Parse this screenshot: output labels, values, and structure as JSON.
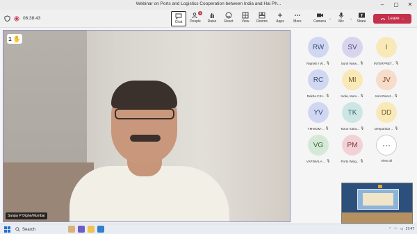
{
  "window": {
    "title": "Webinar on Ports and Logistics Cooperation between India and Hai Ph..."
  },
  "status": {
    "timer": "06:38:43"
  },
  "toolbar": {
    "chat": "Chat",
    "people": "People",
    "people_badge": "1",
    "raise": "Raise",
    "react": "React",
    "view": "View",
    "rooms": "Rooms",
    "apps": "Apps",
    "more": "More",
    "camera": "Camera",
    "mic": "Mic",
    "share": "Share",
    "leave": "Leave"
  },
  "stage": {
    "raised_hands_count": "1",
    "speaker_name": "Sanjay P Dighe/Mumbai"
  },
  "participants": [
    {
      "initials": "RW",
      "name": "Rajnish I W...",
      "color": "blue"
    },
    {
      "initials": "SV",
      "name": "Sunil Vasw...",
      "color": "purple"
    },
    {
      "initials": "I",
      "name": "INTERPRET...",
      "color": "yellow"
    },
    {
      "initials": "RC",
      "name": "Rekha CSI...",
      "color": "blue"
    },
    {
      "initials": "MI",
      "name": "India, Mum...",
      "color": "yellow"
    },
    {
      "initials": "JV",
      "name": "Joint Direct...",
      "color": "peach"
    },
    {
      "initials": "YV",
      "name": "YM-BOM-...",
      "color": "blue"
    },
    {
      "initials": "TK",
      "name": "Tarun Katra...",
      "color": "teal"
    },
    {
      "initials": "DD",
      "name": "Deepankar ...",
      "color": "yellow"
    },
    {
      "initials": "VG",
      "name": "VAPIWALA ...",
      "color": "green"
    },
    {
      "initials": "PM",
      "name": "Ports Wing...",
      "color": "pink"
    },
    {
      "initials": "···",
      "name": "View all",
      "color": "white"
    }
  ],
  "taskbar": {
    "search": "Search",
    "time": "17:47"
  }
}
